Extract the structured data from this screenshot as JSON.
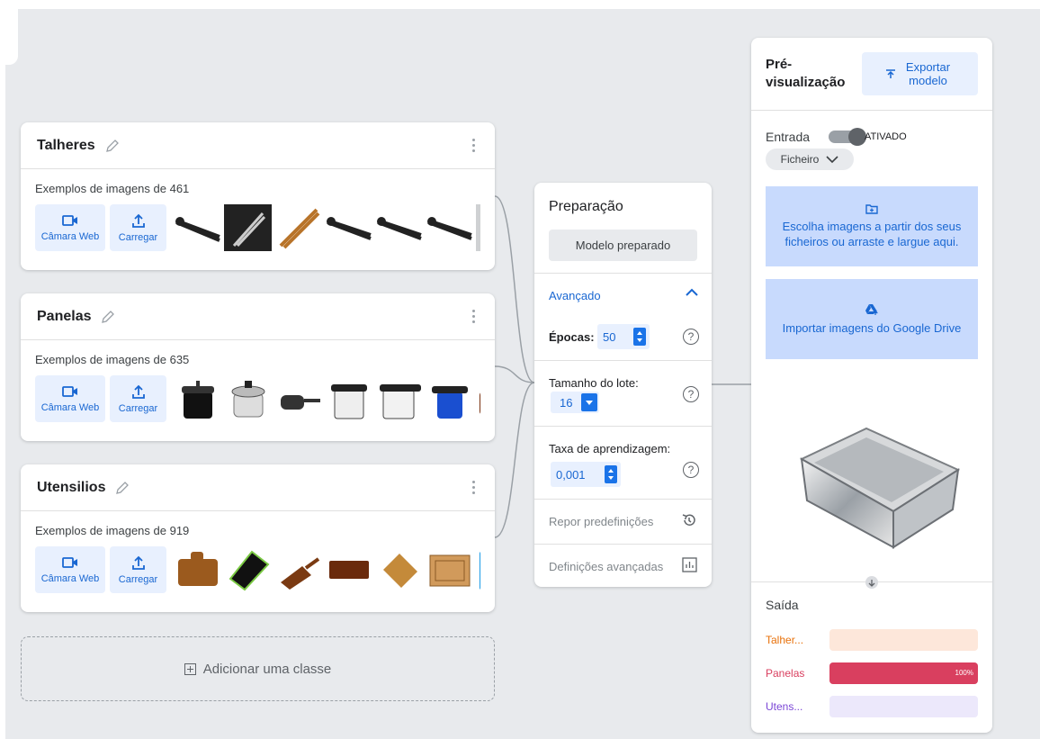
{
  "classes": [
    {
      "name": "Talheres",
      "samples_label": "Exemplos de imagens de 461"
    },
    {
      "name": "Panelas",
      "samples_label": "Exemplos de imagens de 635"
    },
    {
      "name": "Utensilios",
      "samples_label": "Exemplos de imagens de 919"
    }
  ],
  "source_buttons": {
    "webcam": "Câmara Web",
    "upload": "Carregar"
  },
  "add_class_label": "Adicionar uma classe",
  "training": {
    "title": "Preparação",
    "trained_button": "Modelo preparado",
    "advanced_label": "Avançado",
    "epochs_label": "Épocas:",
    "epochs_value": "50",
    "batch_label": "Tamanho do lote:",
    "batch_value": "16",
    "lr_label": "Taxa de aprendizagem:",
    "lr_value": "0,001",
    "reset_label": "Repor predefinições",
    "advanced_settings_label": "Definições avançadas"
  },
  "preview": {
    "title": "Pré-visualização",
    "export_label": "Exportar modelo",
    "input_label": "Entrada",
    "toggle_state": "ATIVADO",
    "source_select": "Ficheiro",
    "file_drop_text": "Escolha imagens a partir dos seus ficheiros ou arraste e largue aqui.",
    "drive_text": "Importar imagens do Google Drive",
    "output_label": "Saída",
    "outputs": [
      {
        "label": "Talher...",
        "percent": 0,
        "color": "#e8710a",
        "bg": "#fde7da"
      },
      {
        "label": "Panelas",
        "percent": 100,
        "percent_text": "100%",
        "color": "#d93f5f",
        "bg": "#d93f5f"
      },
      {
        "label": "Utens...",
        "percent": 0,
        "color": "#7b46d6",
        "bg": "#ece8fb"
      }
    ]
  },
  "colors": {
    "accent": "#1967d2",
    "accent_bg": "#e8f0fe",
    "canvas": "#e8eaed"
  }
}
